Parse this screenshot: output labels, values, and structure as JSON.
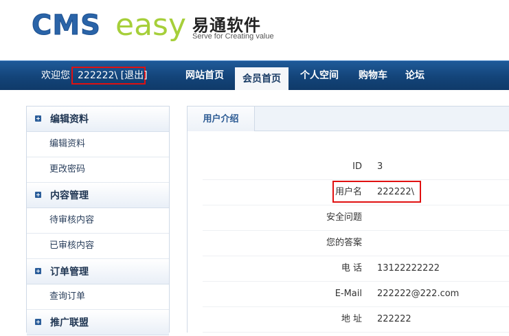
{
  "header": {
    "logo_cms": "CMS",
    "logo_easy": "easy",
    "logo_cn": "易通软件",
    "logo_tagline": "Serve for Creating value"
  },
  "navbar": {
    "welcome": "欢迎您",
    "username": "222222\\",
    "logout": "[退出]",
    "items": [
      {
        "label": "网站首页"
      },
      {
        "label": "会员首页"
      },
      {
        "label": "个人空间"
      },
      {
        "label": "购物车"
      },
      {
        "label": "论坛"
      }
    ],
    "active_index": 1
  },
  "sidebar": {
    "groups": [
      {
        "title": "编辑资料",
        "links": [
          "编辑资料",
          "更改密码"
        ]
      },
      {
        "title": "内容管理",
        "links": [
          "待审核内容",
          "已审核内容"
        ]
      },
      {
        "title": "订单管理",
        "links": [
          "查询订单"
        ]
      },
      {
        "title": "推广联盟",
        "links": []
      }
    ]
  },
  "main": {
    "tab_label": "用户介绍",
    "rows": [
      {
        "label": "ID",
        "value": "3"
      },
      {
        "label": "用户名",
        "value": "222222\\"
      },
      {
        "label": "安全问题",
        "value": ""
      },
      {
        "label": "您的答案",
        "value": ""
      },
      {
        "label": "电 话",
        "value": "13122222222"
      },
      {
        "label": "E-Mail",
        "value": "222222@222.com"
      },
      {
        "label": "地 址",
        "value": "222222"
      }
    ]
  },
  "colors": {
    "nav_bg": "#134479",
    "highlight_box": "#e01010",
    "logo_blue": "#2a64a8",
    "logo_green": "#a6cf3a"
  }
}
